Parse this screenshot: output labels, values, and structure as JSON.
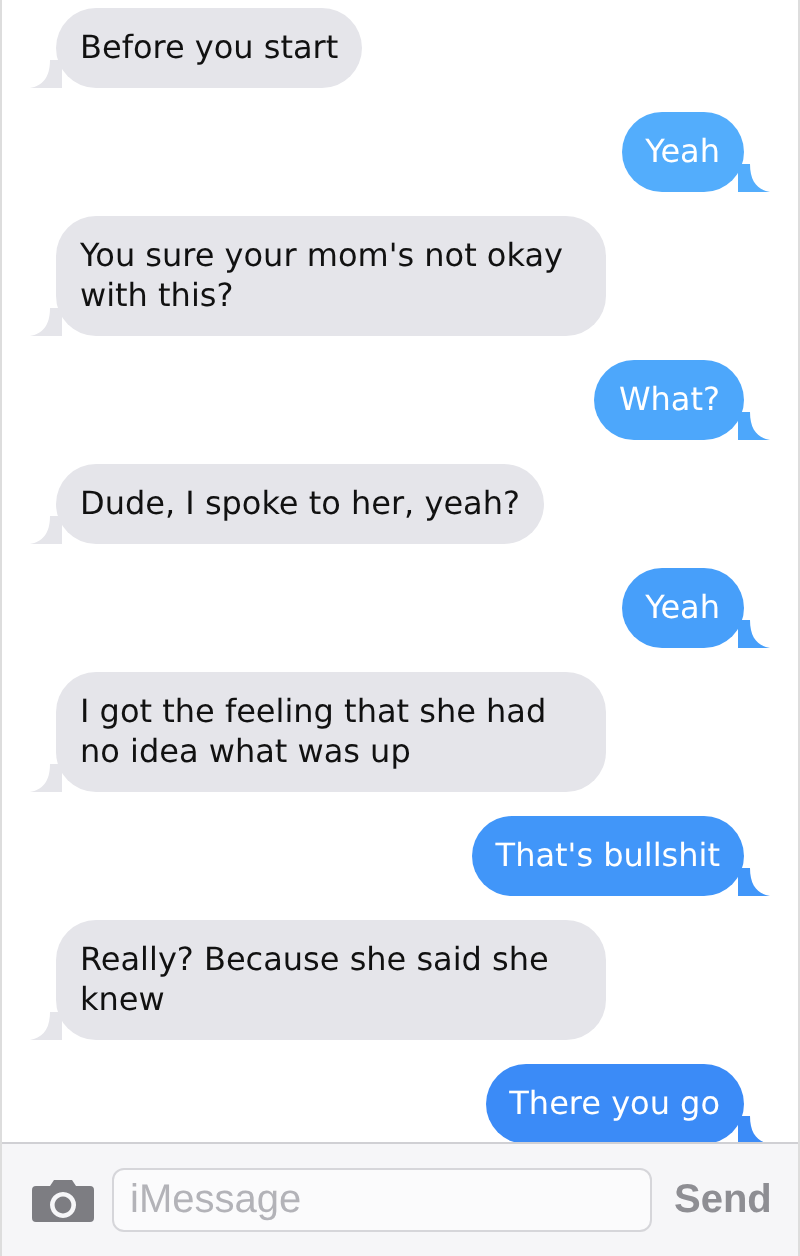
{
  "messages": [
    {
      "kind": "received",
      "text": "Before you start"
    },
    {
      "kind": "sent",
      "text": "Yeah",
      "color": "#53adfc"
    },
    {
      "kind": "received",
      "text": "You sure your mom's not okay with this?"
    },
    {
      "kind": "sent",
      "text": "What?",
      "color": "#4da7fb"
    },
    {
      "kind": "received",
      "text": "Dude, I spoke to her, yeah?"
    },
    {
      "kind": "sent",
      "text": "Yeah",
      "color": "#479ffa"
    },
    {
      "kind": "received",
      "text": "I got the feeling that she had no idea what was up"
    },
    {
      "kind": "sent",
      "text": "That's bullshit",
      "color": "#4196f9"
    },
    {
      "kind": "received",
      "text": "Really? Because she said she knew"
    },
    {
      "kind": "sent",
      "text": "There you go",
      "color": "#3b8bf7"
    }
  ],
  "composer": {
    "placeholder": "iMessage",
    "send": "Send"
  }
}
